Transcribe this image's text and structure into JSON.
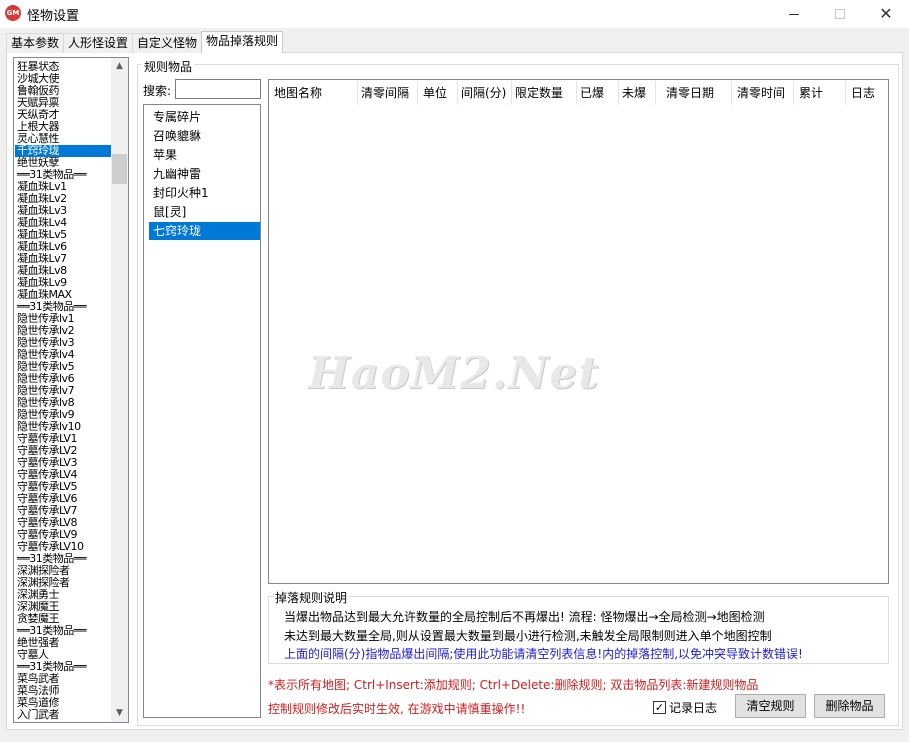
{
  "window": {
    "title": "怪物设置",
    "icon_text": "GM",
    "minimize_icon": "minimize-icon",
    "maximize_icon": "maximize-icon",
    "close_icon": "close-icon"
  },
  "tabs": [
    {
      "label": "基本参数",
      "active": false
    },
    {
      "label": "人形怪设置",
      "active": false
    },
    {
      "label": "自定义怪物",
      "active": false
    },
    {
      "label": "物品掉落规则",
      "active": true
    }
  ],
  "left_list": {
    "selected_index": 7,
    "items": [
      "狂暴状态",
      "沙城大使",
      "鲁翰仮药",
      "天赋异禀",
      "天纵奇才",
      "上根大器",
      "灵心慧性",
      "千窍玲珑",
      "绝世妖孽",
      "══31类物品══",
      "凝血珠Lv1",
      "凝血珠Lv2",
      "凝血珠Lv3",
      "凝血珠Lv4",
      "凝血珠Lv5",
      "凝血珠Lv6",
      "凝血珠Lv7",
      "凝血珠Lv8",
      "凝血珠Lv9",
      "凝血珠MAX",
      "══31类物品══",
      "隐世传承lv1",
      "隐世传承lv2",
      "隐世传承lv3",
      "隐世传承lv4",
      "隐世传承lv5",
      "隐世传承lv6",
      "隐世传承lv7",
      "隐世传承lv8",
      "隐世传承lv9",
      "隐世传承lv10",
      "守墓传承LV1",
      "守墓传承LV2",
      "守墓传承LV3",
      "守墓传承LV4",
      "守墓传承LV5",
      "守墓传承LV6",
      "守墓传承LV7",
      "守墓传承LV8",
      "守墓传承LV9",
      "守墓传承LV10",
      "══31类物品══",
      "深渊探险者",
      "深渊探险者",
      "深渊勇士",
      "深渊魔王",
      "贪婪魔王",
      "══31类物品══",
      "绝世强者",
      "守墓人",
      "══31类物品══",
      "菜鸟武者",
      "菜鸟法师",
      "菜鸟道修",
      "入门武者"
    ]
  },
  "rules_group": {
    "title": "规则物品",
    "search_label": "搜索:",
    "search_value": "",
    "items": [
      "专属碎片",
      "召唤貔貅",
      "苹果",
      "九幽神雷",
      "封印火种1",
      "鼠[灵]",
      "七窍玲珑"
    ],
    "selected_index": 6
  },
  "rules_table": {
    "columns": [
      "地图名称",
      "清零间隔",
      "单位",
      "间隔(分)",
      "限定数量",
      "已爆",
      "未爆",
      "清零日期",
      "清零时间",
      "累计",
      "日志"
    ],
    "rows": []
  },
  "watermark": "HaoM2.Net",
  "description": {
    "title": "掉落规则说明",
    "line1": "当爆出物品达到最大允许数量的全局控制后不再爆出!  流程:  怪物爆出→全局检测→地图检测",
    "line2": "未达到最大数量全局,则从设置最大数量到最小进行检测,未触发全局限制则进入单个地图控制",
    "line3": "上面的间隔(分)指物品爆出间隔;使用此功能请清空列表信息!内的掉落控制,以免冲突导致计数错误!"
  },
  "hints": {
    "line1": "*表示所有地图; Ctrl+Insert:添加规则; Ctrl+Delete:删除规则; 双击物品列表:新建规则物品",
    "line2": "控制规则修改后实时生效, 在游戏中请慎重操作!!"
  },
  "log_checkbox": {
    "label": "记录日志",
    "checked": true,
    "check_mark": "✓"
  },
  "buttons": {
    "clear_rules": "清空规则",
    "delete_item": "删除物品"
  },
  "colors": {
    "selection": "#0078d7",
    "hint_red": "#d21c1c",
    "desc_blue": "#1c1cd6"
  }
}
